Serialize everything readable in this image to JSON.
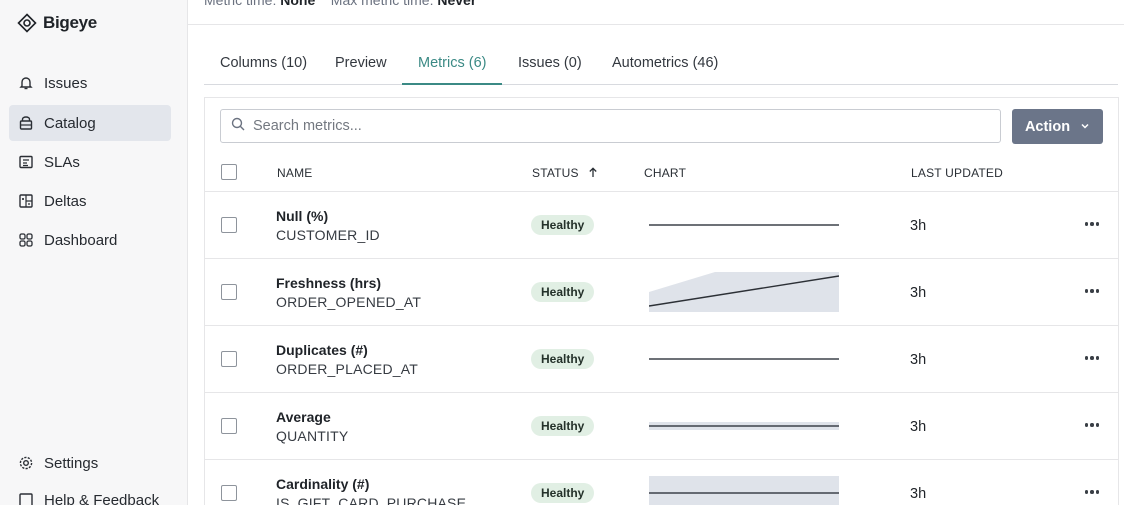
{
  "app": {
    "brand": "Bigeye"
  },
  "meta": {
    "metric_time_label": "Metric time:",
    "metric_time_value": "None",
    "max_metric_time_label": "Max metric time:",
    "max_metric_time_value": "Never"
  },
  "sidebar": {
    "items": [
      {
        "label": "Issues",
        "icon": "bell-icon"
      },
      {
        "label": "Catalog",
        "icon": "database-icon",
        "active": true
      },
      {
        "label": "SLAs",
        "icon": "sla-icon"
      },
      {
        "label": "Deltas",
        "icon": "deltas-icon"
      },
      {
        "label": "Dashboard",
        "icon": "dashboard-icon"
      }
    ],
    "bottom": [
      {
        "label": "Settings",
        "icon": "gear-icon"
      },
      {
        "label": "Help & Feedback",
        "icon": "help-icon"
      }
    ]
  },
  "tabs": [
    {
      "label": "Columns (10)"
    },
    {
      "label": "Preview"
    },
    {
      "label": "Metrics (6)",
      "active": true
    },
    {
      "label": "Issues (0)"
    },
    {
      "label": "Autometrics (46)"
    }
  ],
  "search": {
    "placeholder": "Search metrics..."
  },
  "action": {
    "label": "Action"
  },
  "table": {
    "headers": {
      "name": "NAME",
      "status": "STATUS",
      "chart": "CHART",
      "updated": "LAST UPDATED"
    },
    "sort": {
      "column": "status",
      "direction": "ascending"
    },
    "rows": [
      {
        "name": "Null (%)",
        "column": "CUSTOMER_ID",
        "status": "Healthy",
        "updated": "3h",
        "chart": "flat"
      },
      {
        "name": "Freshness (hrs)",
        "column": "ORDER_OPENED_AT",
        "status": "Healthy",
        "updated": "3h",
        "chart": "rising"
      },
      {
        "name": "Duplicates (#)",
        "column": "ORDER_PLACED_AT",
        "status": "Healthy",
        "updated": "3h",
        "chart": "flat"
      },
      {
        "name": "Average",
        "column": "QUANTITY",
        "status": "Healthy",
        "updated": "3h",
        "chart": "flat-band"
      },
      {
        "name": "Cardinality (#)",
        "column": "IS_GIFT_CARD_PURCHASE",
        "status": "Healthy",
        "updated": "3h",
        "chart": "flat-wide-band"
      }
    ]
  },
  "colors": {
    "accent": "#3b8a85",
    "action_button": "#6b7589",
    "healthy_badge_bg": "#e1efe4",
    "chart_band": "#dfe3ea",
    "sidebar_active": "#e3e6ec"
  }
}
